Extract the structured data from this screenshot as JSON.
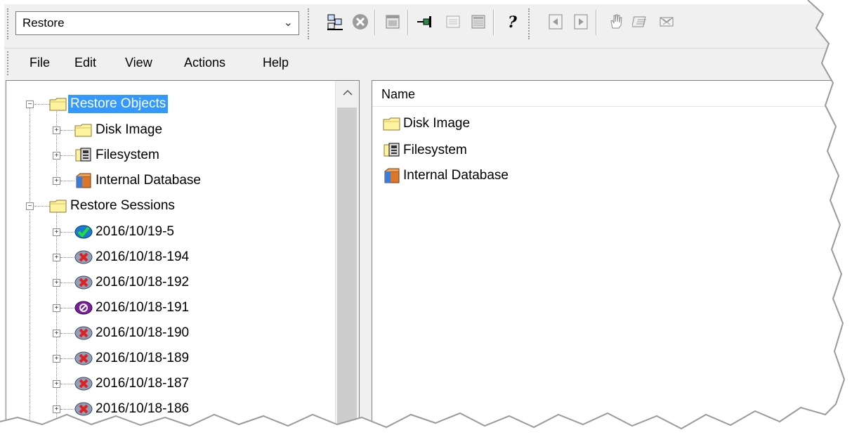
{
  "context_selector": {
    "value": "Restore"
  },
  "menu": [
    "File",
    "Edit",
    "View",
    "Actions",
    "Help"
  ],
  "toolbar_icons": [
    "connect-icon",
    "stop-icon",
    "window-icon",
    "pin-icon",
    "list-view-icon",
    "details-icon",
    "help-icon",
    "back-icon",
    "forward-icon",
    "hand-icon",
    "report-icon",
    "mail-icon"
  ],
  "tree": {
    "root1": {
      "label": "Restore Objects"
    },
    "children1": [
      {
        "label": "Disk Image",
        "icon": "folder-icon"
      },
      {
        "label": "Filesystem",
        "icon": "filesystem-icon"
      },
      {
        "label": "Internal Database",
        "icon": "database-icon"
      }
    ],
    "root2": {
      "label": "Restore Sessions"
    },
    "sessions": [
      {
        "label": "2016/10/19-5",
        "icon": "success-icon"
      },
      {
        "label": "2016/10/18-194",
        "icon": "failed-icon"
      },
      {
        "label": "2016/10/18-192",
        "icon": "failed-icon"
      },
      {
        "label": "2016/10/18-191",
        "icon": "aborted-icon"
      },
      {
        "label": "2016/10/18-190",
        "icon": "failed-icon"
      },
      {
        "label": "2016/10/18-189",
        "icon": "failed-icon"
      },
      {
        "label": "2016/10/18-187",
        "icon": "failed-icon"
      },
      {
        "label": "2016/10/18-186",
        "icon": "failed-icon"
      }
    ]
  },
  "list": {
    "column": "Name",
    "rows": [
      {
        "label": "Disk Image",
        "icon": "folder-icon"
      },
      {
        "label": "Filesystem",
        "icon": "filesystem-icon"
      },
      {
        "label": "Internal Database",
        "icon": "database-icon"
      }
    ]
  },
  "colors": {
    "selection": "#3399ff",
    "folder": "#fff3a0",
    "success": "#22aa33",
    "failed": "#e02020",
    "aborted": "#7a1f9e"
  }
}
